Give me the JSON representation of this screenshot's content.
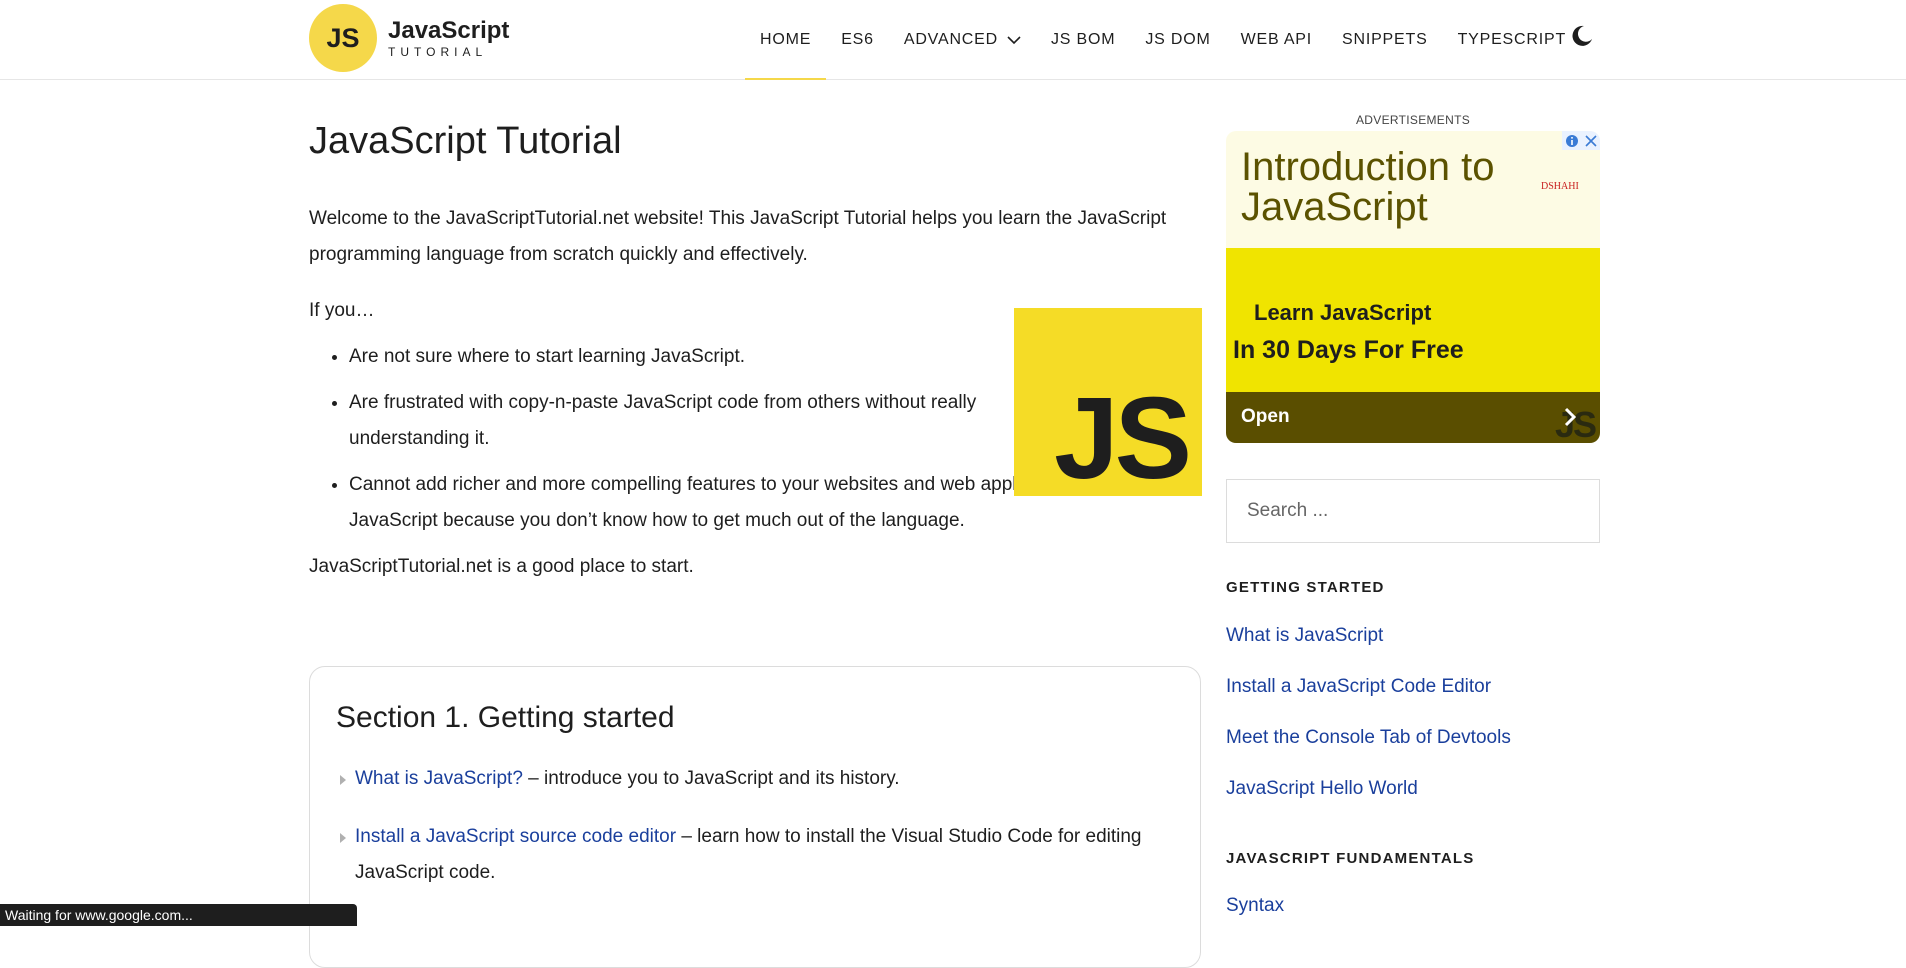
{
  "header": {
    "logo_badge": "JS",
    "logo_title": "JavaScript",
    "logo_sub": "TUTORIAL",
    "nav": [
      "HOME",
      "ES6",
      "ADVANCED",
      "JS BOM",
      "JS DOM",
      "WEB API",
      "SNIPPETS",
      "TYPESCRIPT"
    ],
    "active_nav": "HOME"
  },
  "main": {
    "title": "JavaScript Tutorial",
    "intro": "Welcome to the JavaScriptTutorial.net website! This JavaScript Tutorial helps you learn the JavaScript programming language from scratch quickly and effectively.",
    "if_you": "If you…",
    "bullets": [
      "Are not sure where to start learning JavaScript.",
      "Are frustrated with copy-n-paste JavaScript code from others without really understanding it.",
      "Cannot add richer and more compelling features to your websites and web applications using JavaScript because you don’t know how to get much out of the language."
    ],
    "js_image_text": "JS",
    "start": "JavaScriptTutorial.net is a good place to start.",
    "section": {
      "title": "Section 1. Getting started",
      "items": [
        {
          "link": "What is JavaScript?",
          "desc": " – introduce you to JavaScript and its history."
        },
        {
          "link": "Install a JavaScript source code editor",
          "desc": " – learn how to install the Visual Studio Code for editing JavaScript code."
        }
      ]
    }
  },
  "sidebar": {
    "ads_label": "ADVERTISEMENTS",
    "ad": {
      "headline": "Introduction to JavaScript",
      "brand": "DSHAHI",
      "line1": "Learn JavaScript",
      "line2": "In 30 Days For Free",
      "open": "Open",
      "corner_text": "JS"
    },
    "search_placeholder": "Search ...",
    "getting_started_head": "GETTING STARTED",
    "getting_started_links": [
      "What is JavaScript",
      "Install a JavaScript Code Editor",
      "Meet the Console Tab of Devtools",
      "JavaScript Hello World"
    ],
    "fundamentals_head": "JAVASCRIPT FUNDAMENTALS",
    "fundamentals_links": [
      "Syntax"
    ]
  },
  "status_bar": "Waiting for www.google.com...",
  "colors": {
    "brand_yellow": "#f5d84a",
    "link_blue": "#1a3f9c"
  }
}
